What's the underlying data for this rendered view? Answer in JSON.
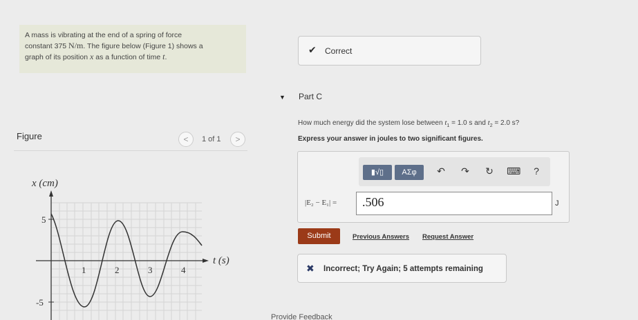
{
  "problem": {
    "line1": "A mass is vibrating at the end of a spring of force",
    "line2_pre": "constant 375 ",
    "line2_unit": "N/m",
    "line2_post": ". The figure below (Figure 1) shows a",
    "line3_pre": "graph of its position ",
    "line3_var": "x",
    "line3_mid": " as a function of time ",
    "line3_var2": "t",
    "line3_post": "."
  },
  "figure": {
    "label": "Figure",
    "prev": "<",
    "count": "1 of 1",
    "next": ">"
  },
  "graph": {
    "y_axis_label": "x (cm)",
    "x_axis_label": "t (s)",
    "y_ticks": [
      "5",
      "-5"
    ],
    "x_ticks": [
      "1",
      "2",
      "3",
      "4"
    ]
  },
  "correct_box": {
    "icon": "check-icon",
    "text": "Correct"
  },
  "part": {
    "title": "Part C",
    "arrow_icon": "triangle-down-icon"
  },
  "question": {
    "pre": "How much energy did the system lose between ",
    "t1": "t",
    "t1_sub": "1",
    "mid1": " = 1.0 s and ",
    "t2": "t",
    "t2_sub": "2",
    "post": " = 2.0 s?",
    "instructions": "Express your answer in joules to two significant figures."
  },
  "toolbar": {
    "template_btn": "▮√▯",
    "symbol_btn": "ΑΣφ",
    "undo_icon": "↶",
    "redo_icon": "↷",
    "reset_icon": "↻",
    "keyboard_icon": "⌨",
    "help_icon": "?"
  },
  "answer": {
    "expr_label": "|E₂ − E₁| =",
    "value": ".506",
    "unit": "J"
  },
  "actions": {
    "submit": "Submit",
    "previous_answers": "Previous Answers",
    "request_answer": "Request Answer"
  },
  "incorrect_box": {
    "icon": "x-icon",
    "text": "Incorrect; Try Again; 5 attempts remaining"
  },
  "footer": {
    "feedback": "Provide Feedback"
  },
  "colors": {
    "submit_bg": "#9b3a18",
    "problem_bg": "#e6e8d9",
    "toolbar_btn": "#5e6f8a"
  }
}
